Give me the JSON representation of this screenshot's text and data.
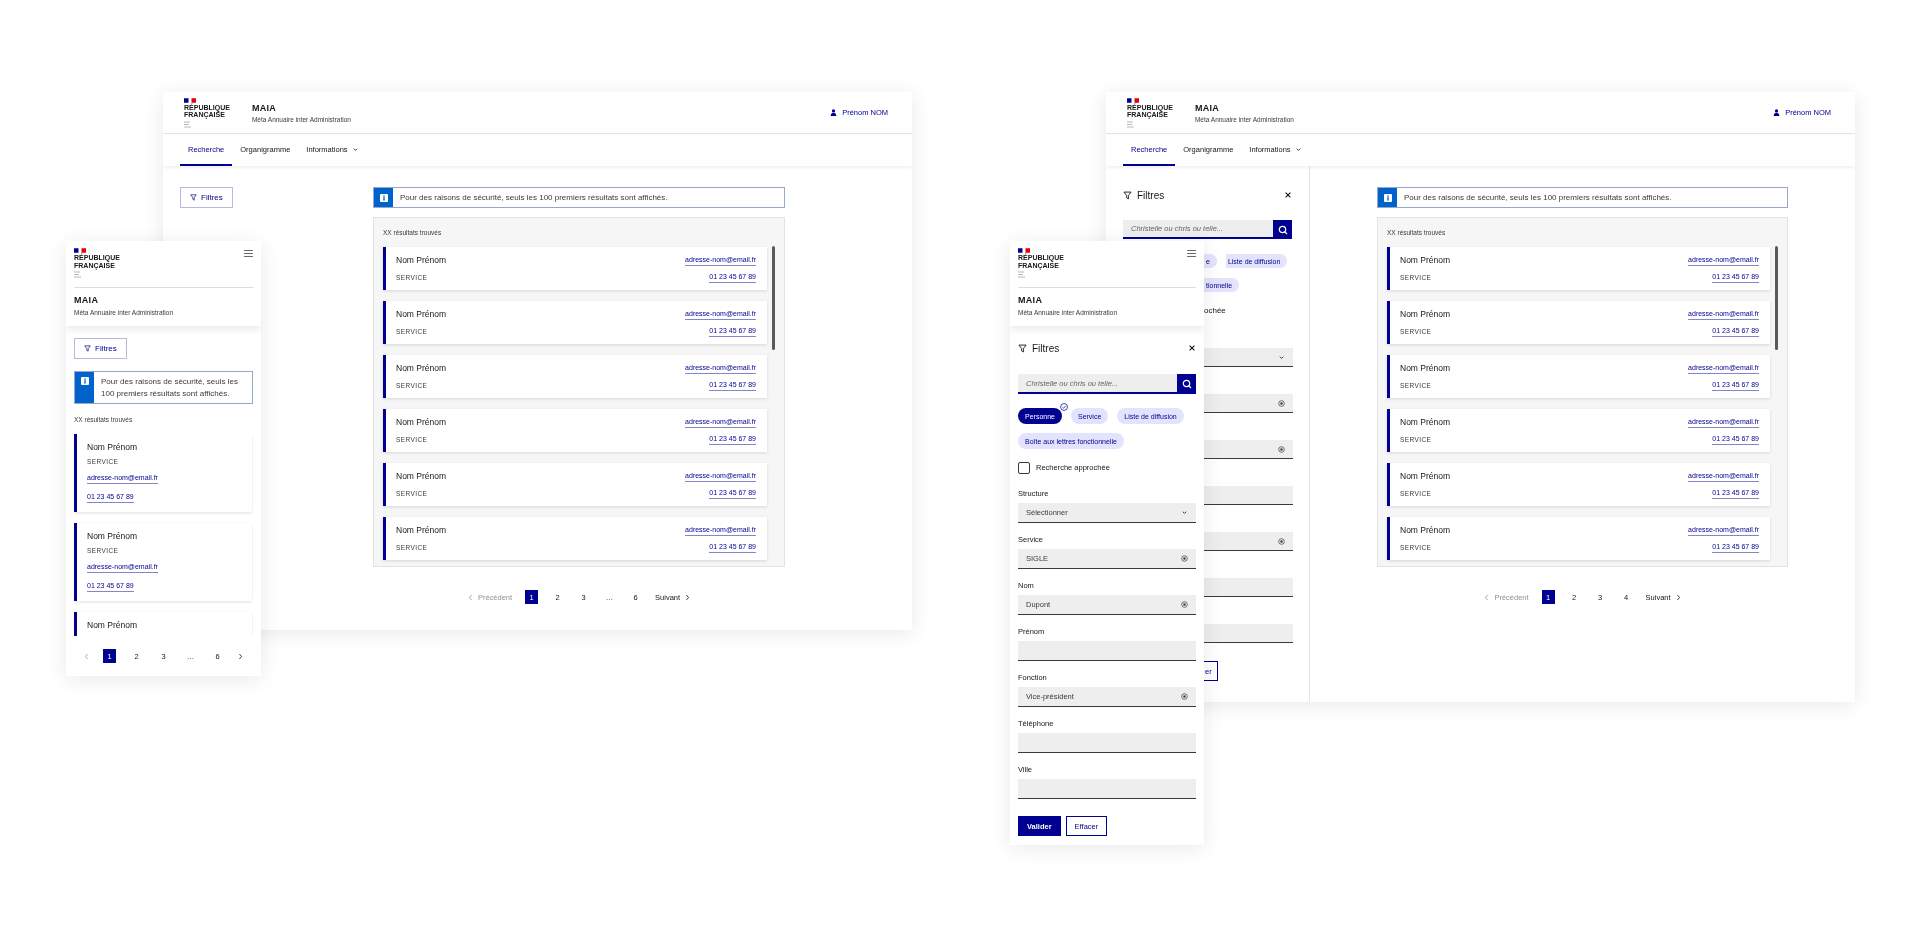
{
  "desktop_results_view": {
    "header": {
      "logo_lines": [
        "RÉPUBLIQUE",
        "FRANÇAISE"
      ],
      "title": "MAIA",
      "subtitle": "Méta Annuaire inter Administration",
      "user": "Prénom NOM"
    },
    "nav": [
      {
        "label": "Recherche",
        "selected": true,
        "dropdown": false
      },
      {
        "label": "Organigramme",
        "selected": false,
        "dropdown": false
      },
      {
        "label": "Informations",
        "selected": false,
        "dropdown": true
      }
    ],
    "filters_button": "Filtres",
    "notice": "Pour des raisons de sécurité, seuls les 100 premiers résultats sont affichés.",
    "results_count": "XX résultats trouvés",
    "results": [
      {
        "name": "Nom Prénom",
        "service": "SERVICE",
        "email": "adresse-nom@email.fr",
        "phone": "01 23 45 67 89"
      },
      {
        "name": "Nom Prénom",
        "service": "SERVICE",
        "email": "adresse-nom@email.fr",
        "phone": "01 23 45 67 89"
      },
      {
        "name": "Nom Prénom",
        "service": "SERVICE",
        "email": "adresse-nom@email.fr",
        "phone": "01 23 45 67 89"
      },
      {
        "name": "Nom Prénom",
        "service": "SERVICE",
        "email": "adresse-nom@email.fr",
        "phone": "01 23 45 67 89"
      },
      {
        "name": "Nom Prénom",
        "service": "SERVICE",
        "email": "adresse-nom@email.fr",
        "phone": "01 23 45 67 89"
      },
      {
        "name": "Nom Prénom",
        "service": "SERVICE",
        "email": "adresse-nom@email.fr",
        "phone": "01 23 45 67 89"
      }
    ],
    "pagination": {
      "previous": "Précédent",
      "next": "Suivant",
      "pages": [
        {
          "label": "1",
          "selected": true
        },
        {
          "label": "2",
          "selected": false
        },
        {
          "label": "3",
          "selected": false
        },
        {
          "label": "…",
          "selected": false
        },
        {
          "label": "6",
          "selected": false
        }
      ]
    }
  },
  "mobile_results_view": {
    "header": {
      "logo_lines": [
        "RÉPUBLIQUE",
        "FRANÇAISE"
      ],
      "title": "MAIA",
      "subtitle": "Méta Annuaire inter Administration"
    },
    "filters_button": "Filtres",
    "notice": "Pour des raisons de sécurité, seuls les 100 premiers résultats sont affichés.",
    "results_count": "XX résultats trouvés",
    "results": [
      {
        "name": "Nom Prénom",
        "service": "SERVICE",
        "email": "adresse-nom@email.fr",
        "phone": "01 23 45 67 89"
      },
      {
        "name": "Nom Prénom",
        "service": "SERVICE",
        "email": "adresse-nom@email.fr",
        "phone": "01 23 45 67 89"
      },
      {
        "name": "Nom Prénom"
      }
    ],
    "pagination": {
      "pages": [
        {
          "label": "1",
          "selected": true
        },
        {
          "label": "2",
          "selected": false
        },
        {
          "label": "3",
          "selected": false
        },
        {
          "label": "…",
          "selected": false
        },
        {
          "label": "6",
          "selected": false
        }
      ]
    }
  },
  "desktop_filters_view": {
    "header": {
      "logo_lines": [
        "RÉPUBLIQUE",
        "FRANÇAISE"
      ],
      "title": "MAIA",
      "subtitle": "Méta Annuaire inter Administration",
      "user": "Prénom NOM"
    },
    "nav": [
      {
        "label": "Recherche",
        "selected": true,
        "dropdown": false
      },
      {
        "label": "Organigramme",
        "selected": false,
        "dropdown": false
      },
      {
        "label": "Informations",
        "selected": false,
        "dropdown": true
      }
    ],
    "filters": {
      "title": "Filtres",
      "search_placeholder": "Christelle ou chris ou telle...",
      "chips": [
        {
          "label": "e",
          "selected": false
        },
        {
          "label": "Liste de diffusion",
          "selected": false
        },
        {
          "label": "tionnelle",
          "selected": false
        }
      ],
      "approx_label": "ochée",
      "fields": [
        {
          "kind": "select"
        },
        {
          "kind": "text",
          "clearable": true
        },
        {
          "kind": "text",
          "clearable": true
        },
        {
          "kind": "text",
          "clearable": false
        },
        {
          "kind": "text",
          "clearable": true
        },
        {
          "kind": "text",
          "clearable": false
        },
        {
          "kind": "text",
          "clearable": false
        }
      ],
      "clear_button": "er"
    },
    "notice": "Pour des raisons de sécurité, seuls les 100 premiers résultats sont affichés.",
    "results_count": "XX résultats trouvés",
    "results": [
      {
        "name": "Nom Prénom",
        "service": "SERVICE",
        "email": "adresse-nom@email.fr",
        "phone": "01 23 45 67 89"
      },
      {
        "name": "Nom Prénom",
        "service": "SERVICE",
        "email": "adresse-nom@email.fr",
        "phone": "01 23 45 67 89"
      },
      {
        "name": "Nom Prénom",
        "service": "SERVICE",
        "email": "adresse-nom@email.fr",
        "phone": "01 23 45 67 89"
      },
      {
        "name": "Nom Prénom",
        "service": "SERVICE",
        "email": "adresse-nom@email.fr",
        "phone": "01 23 45 67 89"
      },
      {
        "name": "Nom Prénom",
        "service": "SERVICE",
        "email": "adresse-nom@email.fr",
        "phone": "01 23 45 67 89"
      },
      {
        "name": "Nom Prénom",
        "service": "SERVICE",
        "email": "adresse-nom@email.fr",
        "phone": "01 23 45 67 89"
      }
    ],
    "pagination": {
      "previous": "Précédent",
      "next": "Suivant",
      "pages": [
        {
          "label": "1",
          "selected": true
        },
        {
          "label": "2",
          "selected": false
        },
        {
          "label": "3",
          "selected": false
        },
        {
          "label": "4",
          "selected": false
        }
      ]
    }
  },
  "mobile_filters_view": {
    "header": {
      "logo_lines": [
        "RÉPUBLIQUE",
        "FRANÇAISE"
      ],
      "title": "MAIA",
      "subtitle": "Méta Annuaire inter Administration"
    },
    "filters": {
      "title": "Filtres",
      "search_placeholder": "Christelle ou chris ou telle...",
      "chips": [
        {
          "label": "Personne",
          "selected": true
        },
        {
          "label": "Service",
          "selected": false
        },
        {
          "label": "Liste de diffusion",
          "selected": false
        },
        {
          "label": "Boîte aux lettres fonctionnelle",
          "selected": false
        }
      ],
      "approx": {
        "label": "Recherche approchée",
        "checked": false
      },
      "fields": [
        {
          "kind": "select",
          "label": "Structure",
          "value": "Sélectionner"
        },
        {
          "kind": "text",
          "label": "Service",
          "value": "SIGLE"
        },
        {
          "kind": "text",
          "label": "Nom",
          "value": "Dupont"
        },
        {
          "kind": "text",
          "label": "Prénom"
        },
        {
          "kind": "text",
          "label": "Fonction",
          "value": "Vice-président"
        },
        {
          "kind": "text",
          "label": "Téléphone"
        },
        {
          "kind": "text",
          "label": "Ville"
        }
      ],
      "submit_button": "Valider",
      "clear_button": "Effacer"
    }
  }
}
